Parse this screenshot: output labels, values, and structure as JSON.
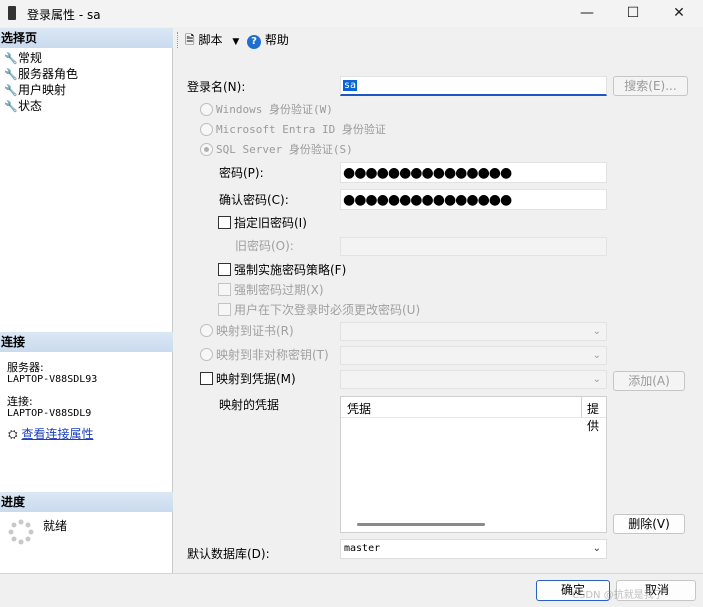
{
  "window": {
    "title": "登录属性 - sa"
  },
  "left": {
    "select_page_heading": "选择页",
    "pages": [
      {
        "label": "常规"
      },
      {
        "label": "服务器角色"
      },
      {
        "label": "用户映射"
      },
      {
        "label": "状态"
      }
    ],
    "connection_heading": "连接",
    "server_label": "服务器:",
    "server_value": "LAPTOP-V88SDL93",
    "connection_label": "连接:",
    "connection_value": "LAPTOP-V88SDL9",
    "view_connection_link": "查看连接属性",
    "progress_heading": "进度",
    "progress_status": "就绪"
  },
  "toolbar": {
    "script_label": "脚本",
    "help_label": "帮助"
  },
  "form": {
    "login_name_label": "登录名(N):",
    "login_name_value": "sa",
    "search_button": "搜索(E)...",
    "windows_auth": "Windows 身份验证(W)",
    "entra_auth": "Microsoft Entra ID 身份验证",
    "sql_auth": "SQL Server 身份验证(S)",
    "password_label": "密码(P):",
    "password_value": "●●●●●●●●●●●●●●●",
    "confirm_password_label": "确认密码(C):",
    "confirm_password_value": "●●●●●●●●●●●●●●●",
    "specify_old_password": "指定旧密码(I)",
    "old_password_label": "旧密码(O):",
    "enforce_policy": "强制实施密码策略(F)",
    "enforce_expiration": "强制密码过期(X)",
    "must_change": "用户在下次登录时必须更改密码(U)",
    "map_certificate": "映射到证书(R)",
    "map_asymmetric_key": "映射到非对称密钥(T)",
    "map_credential": "映射到凭据(M)",
    "add_button": "添加(A)",
    "mapped_credentials_label": "映射的凭据",
    "credential_columns": [
      "凭据",
      "提供"
    ],
    "delete_button": "删除(V)",
    "default_database_label": "默认数据库(D):",
    "default_database_value": "master"
  },
  "footer": {
    "ok_button": "确定",
    "cancel_button": "取消",
    "watermark": "CSDN @抗就是我了"
  }
}
